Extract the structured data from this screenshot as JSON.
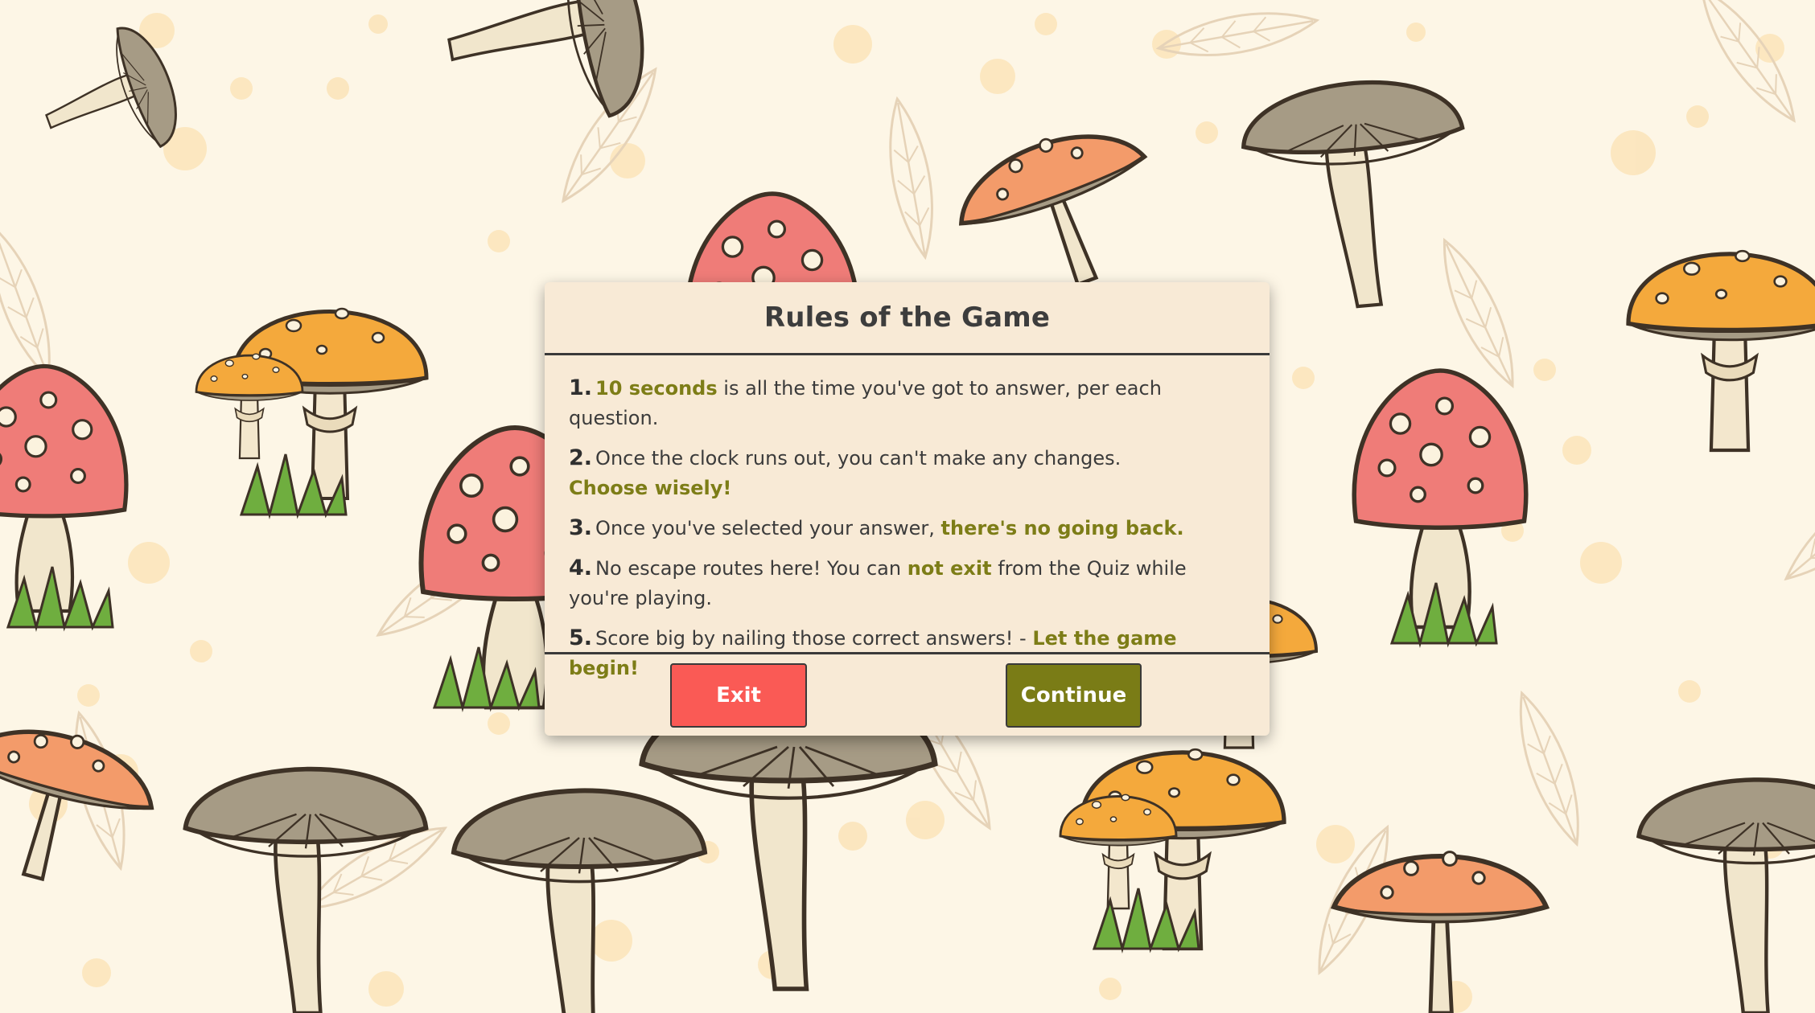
{
  "background": {
    "theme": "illustrated-mushroom-pattern",
    "colors": {
      "base": "#fdf6e6",
      "dot": "#fbe3b6",
      "leaf": "#e8d6bd",
      "cap_orange": "#f4a93c",
      "cap_red": "#ef7c78",
      "cap_salmon": "#f39b6a",
      "cap_grey": "#a69b85",
      "stem": "#f1e6cc",
      "outline": "#3e3226",
      "grass": "#6fae3f"
    }
  },
  "modal": {
    "title": "Rules of the Game",
    "rules": [
      {
        "num": "1.",
        "parts": [
          {
            "text": "10 seconds",
            "style": "hl"
          },
          {
            "text": " is all the time you've got to answer, per each question.",
            "style": "plain"
          }
        ]
      },
      {
        "num": "2.",
        "parts": [
          {
            "text": "Once the clock runs out, you can't make any changes. ",
            "style": "plain"
          },
          {
            "text": "Choose wisely!",
            "style": "hl-bold",
            "break_before": true
          }
        ]
      },
      {
        "num": "3.",
        "parts": [
          {
            "text": "Once you've selected your answer, ",
            "style": "plain"
          },
          {
            "text": "there's no going back.",
            "style": "hl-bold"
          }
        ]
      },
      {
        "num": "4.",
        "parts": [
          {
            "text": "No escape routes here! You can ",
            "style": "plain"
          },
          {
            "text": "not exit",
            "style": "hl-bold"
          },
          {
            "text": " from the Quiz while you're playing.",
            "style": "plain"
          }
        ]
      },
      {
        "num": "5.",
        "parts": [
          {
            "text": "Score big by nailing those correct answers! - ",
            "style": "plain"
          },
          {
            "text": "Let the game begin!",
            "style": "hl-bold"
          }
        ]
      }
    ],
    "buttons": {
      "exit_label": "Exit",
      "continue_label": "Continue"
    },
    "colors": {
      "panel": "#f8ead6",
      "highlight": "#7d7d17",
      "exit": "#fa5a55",
      "continue": "#7a7c16"
    }
  }
}
